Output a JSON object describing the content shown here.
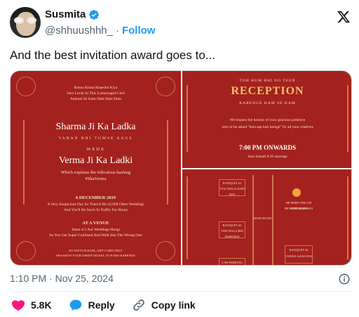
{
  "author": {
    "name": "Susmita",
    "handle": "@shhuushhh_",
    "separator": "·",
    "follow_label": "Follow"
  },
  "tweet": {
    "text": "And the best invitation award goes to..."
  },
  "card1": {
    "intro1": "Banna Kinna Khaeche Kiya",
    "intro2": "Jaisi Lovik Ai This Lomarraged Card",
    "intro3": "Ambani Se Kam Nahi Hain Hum",
    "groom": "Sharma Ji Ka Ladka",
    "tag": "YAHAN BHI TUMSE AAGE",
    "weds": "WEDS",
    "bride": "Verma Ji Ka Ladki",
    "explain": "Which explains the ridiculous hashtag",
    "hashtag": "#ShaVerma",
    "date": "6 DECEMBER 2019",
    "date_sub1": "A Very Auspicious Day So There'll Be 22,000 Other Weddings",
    "date_sub2": "And You'll Be Stuck In Traffic For Hours",
    "venue": "AT A VENUE",
    "venue_sub1": "Jahan 4-5 Aur Weddings Hongi",
    "venue_sub2": "So You Get Super Confused And Walk Into The Wrong One",
    "foot1": "NO GIFTS PLEASE, GIFT CARD ONLY",
    "foot2": "SHAADI IS YOUR GREEN SIGNAL TO KARO KARENGE"
  },
  "card2": {
    "top": "TOH HUM BHI DO TEEN",
    "title": "RECEPTION",
    "sub": "KARENGE KAM SE KAM",
    "body1": "We request the honour of your gracious presence",
    "body2": "only to be asked \"beta aap kab karoge\" by all your relatives",
    "time": "7:00 PM ONWARDS",
    "time_sub": "bass khaadi 8:30 aayenge"
  },
  "card3": {
    "b1": "BANQUET #1",
    "b1s": "YOU WALA NAHI HAI",
    "b2": "BANQUET #2",
    "b2s": "YEH WALA BHI NAHI HAI",
    "road": "MAIN ROAD",
    "car": "CAR PARKING",
    "r1": "HE HERE THE LIE LANDMARK",
    "r1s": "HE HERE NAHI HAI",
    "b3": "BANQUET #3",
    "b3s": "YAHAN AANA HAI"
  },
  "meta": {
    "timestamp": "1:10 PM · Nov 25, 2024"
  },
  "actions": {
    "likes": "5.8K",
    "reply_label": "Reply",
    "copy_label": "Copy link"
  },
  "colors": {
    "accent": "#1d9bf0",
    "like": "#f91880",
    "invite_red": "#a3211e",
    "invite_gold": "#f5c26b"
  }
}
